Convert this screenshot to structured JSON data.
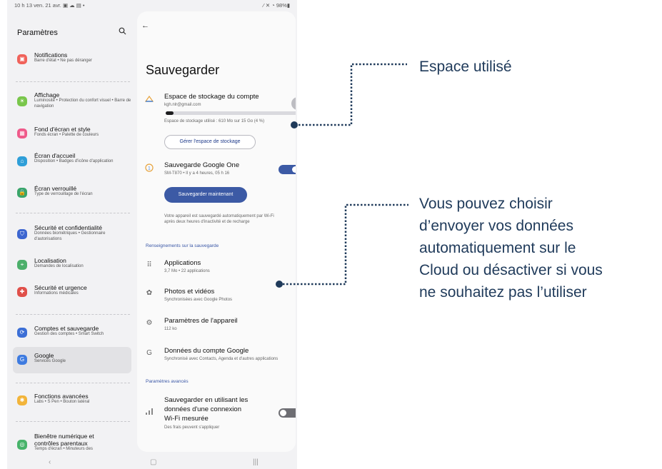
{
  "status_bar": {
    "left": "10 h 13  ven. 21 avr.  ▣ ☁ ▤ •",
    "right": "⁄ ✕ ◔ 98%▮"
  },
  "settings": {
    "title": "Paramètres",
    "search_icon": "search-icon",
    "items": [
      {
        "label": "Notifications",
        "sub": "Barre d'état  •  Ne pas déranger",
        "color": "#f0625a",
        "glyph": "▣"
      },
      {
        "label": "Affichage",
        "sub": "Luminosité  •  Protection du confort visuel  •  Barre de navigation",
        "color": "#79c64b",
        "glyph": "☀"
      },
      {
        "label": "Fond d'écran et style",
        "sub": "Fonds écran  •  Palette de couleurs",
        "color": "#ef5a8a",
        "glyph": "▦"
      },
      {
        "label": "Écran d'accueil",
        "sub": "Disposition  •  Badges d'icône d'application",
        "color": "#2f9fd8",
        "glyph": "⌂"
      },
      {
        "label": "Écran verrouillé",
        "sub": "Type de verrouillage de l'écran",
        "color": "#3aa56a",
        "glyph": "🔒"
      },
      {
        "label": "Sécurité et confidentialité",
        "sub": "Données biométriques  •  Gestionnaire d'autorisations",
        "color": "#3d66d0",
        "glyph": "⛉"
      },
      {
        "label": "Localisation",
        "sub": "Demandes de localisation",
        "color": "#4caf6b",
        "glyph": "⌖"
      },
      {
        "label": "Sécurité et urgence",
        "sub": "Informations médicales",
        "color": "#e0504a",
        "glyph": "✚"
      },
      {
        "label": "Comptes et sauvegarde",
        "sub": "Gestion des comptes  •  Smart Switch",
        "color": "#3c6fd6",
        "glyph": "⟳"
      },
      {
        "label": "Google",
        "sub": "Services Google",
        "color": "#3e7be0",
        "glyph": "G"
      },
      {
        "label": "Fonctions avancées",
        "sub": "Labs  •  S Pen  •  Bouton latéral",
        "color": "#f2b43a",
        "glyph": "✱"
      },
      {
        "label": "Bienêtre numérique et contrôles parentaux",
        "sub": "Temps d'écran  •  Minuteurs des",
        "color": "#47b36a",
        "glyph": "◎"
      }
    ]
  },
  "detail": {
    "back": "←",
    "title": "Sauvegarder",
    "storage": {
      "label": "Espace de stockage du compte",
      "account": "kgh.nlr@gmail.com",
      "usage": "Espace de stockage utilisé : 610 Mo sur 15 Go (4 %)",
      "used_fraction": 0.04,
      "manage_button": "Gérer l'espace de stockage"
    },
    "google_one": {
      "label": "Sauvegarde Google One",
      "sub": "SM-T870 • Il y a 4 heures, 05 h 16",
      "enabled": true,
      "backup_button": "Sauvegarder maintenant",
      "note_line1": "Votre appareil est sauvegardé automatiquement par Wi-Fi",
      "note_line2": "après deux heures d'inactivité et de recharge"
    },
    "section_info": "Renseignements sur la sauvegarde",
    "rows": [
      {
        "label": "Applications",
        "sub": "3,7 Mo • 22 applications",
        "icon": "apps-grid-icon",
        "glyph": "⠿"
      },
      {
        "label": "Photos et vidéos",
        "sub": "Synchronisées avec Google Photos",
        "icon": "photos-icon",
        "glyph": "✿"
      },
      {
        "label": "Paramètres de l'appareil",
        "sub": "112 ko",
        "icon": "gear-icon",
        "glyph": "⚙"
      },
      {
        "label": "Données du compte Google",
        "sub": "Synchronisé avec Contacts, Agenda et d'autres applications",
        "icon": "google-icon",
        "glyph": "G"
      }
    ],
    "section_advanced": "Paramètres avancés",
    "metered": {
      "line1": "Sauvegarder en utilisant les",
      "line2": "données d'une connexion",
      "line3": "Wi-Fi mesurée",
      "sub": "Des frais peuvent s'appliquer",
      "enabled": false
    }
  },
  "nav": {
    "back": "‹",
    "home": "▢",
    "recents": "|||"
  },
  "annotations": {
    "storage": "Espace utilisé",
    "backup_lines": [
      "Vous pouvez choisir",
      "d’envoyer vos données",
      "automatiquement sur le",
      "Cloud ou désactiver si vous",
      "ne souhaitez pas l’utiliser"
    ]
  },
  "colors": {
    "accent": "#3c5aa5",
    "annotation": "#1f3a5a",
    "toggle_on": "#3c5aa5",
    "toggle_off": "#6e6e73"
  }
}
